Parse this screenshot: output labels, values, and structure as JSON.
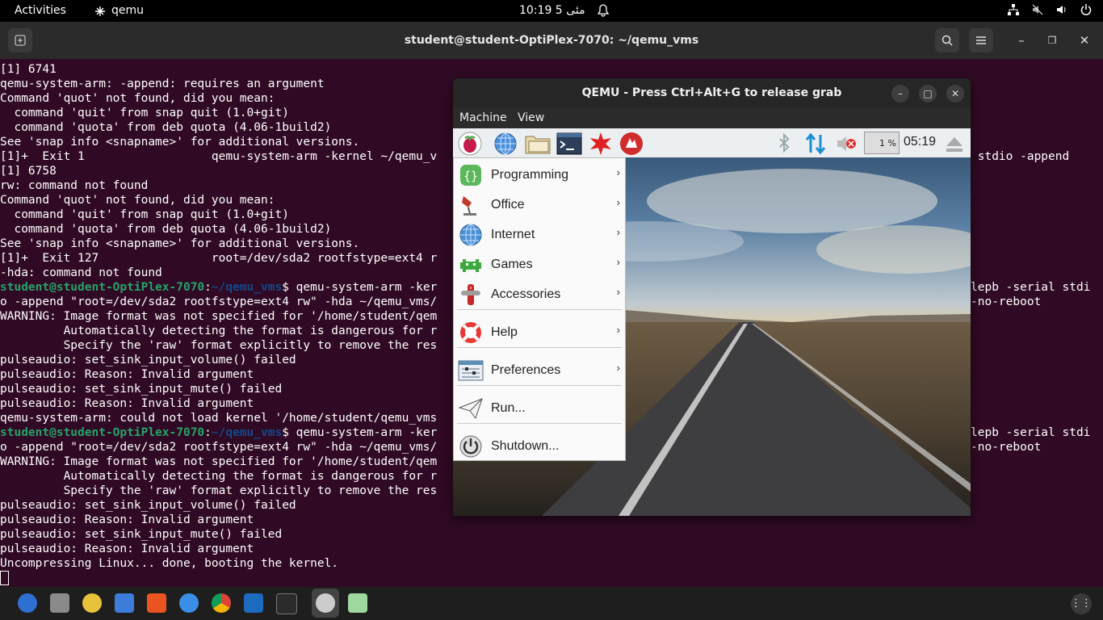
{
  "topbar": {
    "activities": "Activities",
    "app_name": "qemu",
    "clock": "10:19  مئی 5",
    "icons": [
      "network-icon",
      "speaker-muted-icon",
      "volume-icon",
      "power-icon"
    ]
  },
  "terminal": {
    "title": "student@student-OptiPlex-7070: ~/qemu_vms",
    "lines": [
      "[1] 6741",
      "qemu-system-arm: -append: requires an argument",
      "Command 'quot' not found, did you mean:",
      "  command 'quit' from snap quit (1.0+git)",
      "  command 'quota' from deb quota (4.06-1build2)",
      "See 'snap info <snapname>' for additional versions.",
      "[1]+  Exit 1                  qemu-system-arm -kernel ~/qemu_v",
      "[1] 6758",
      "rw: command not found",
      "Command 'quot' not found, did you mean:",
      "  command 'quit' from snap quit (1.0+git)",
      "  command 'quota' from deb quota (4.06-1build2)",
      "See 'snap info <snapname>' for additional versions.",
      "[1]+  Exit 127                root=/dev/sda2 rootfstype=ext4 r",
      "-hda: command not found",
      "PROMPT qemu-system-arm -ker",
      "o -append \"root=/dev/sda2 rootfstype=ext4 rw\" -hda ~/qemu_vms/",
      "WARNING: Image format was not specified for '/home/student/qem",
      "         Automatically detecting the format is dangerous for r",
      "         Specify the 'raw' format explicitly to remove the res",
      "pulseaudio: set_sink_input_volume() failed",
      "pulseaudio: Reason: Invalid argument",
      "pulseaudio: set_sink_input_mute() failed",
      "pulseaudio: Reason: Invalid argument",
      "qemu-system-arm: could not load kernel '/home/student/qemu_vms",
      "PROMPT qemu-system-arm -ker",
      "o -append \"root=/dev/sda2 rootfstype=ext4 rw\" -hda ~/qemu_vms/",
      "WARNING: Image format was not specified for '/home/student/qem",
      "         Automatically detecting the format is dangerous for r",
      "         Specify the 'raw' format explicitly to remove the res",
      "pulseaudio: set_sink_input_volume() failed",
      "pulseaudio: Reason: Invalid argument",
      "pulseaudio: set_sink_input_mute() failed",
      "pulseaudio: Reason: Invalid argument",
      "Uncompressing Linux... done, booting the kernel."
    ],
    "prompt_user": "student@student-OptiPlex-7070",
    "prompt_sep": ":",
    "prompt_path": "~/qemu_vms",
    "prompt_dollar": "$ ",
    "right_lines": [
      {
        "row": 6,
        "text": " stdio -append"
      },
      {
        "row": 15,
        "text": "lepb -serial stdi"
      },
      {
        "row": 16,
        "text": "-no-reboot"
      },
      {
        "row": 25,
        "text": "lepb -serial stdi"
      },
      {
        "row": 26,
        "text": "-no-reboot"
      }
    ]
  },
  "qemu": {
    "title": "QEMU - Press Ctrl+Alt+G to release grab",
    "menu": {
      "machine": "Machine",
      "view": "View"
    },
    "panel": {
      "cpu": "1 %",
      "clock": "05:19"
    },
    "start_menu": [
      {
        "label": "Programming",
        "icon": "programming-icon",
        "submenu": true
      },
      {
        "label": "Office",
        "icon": "office-icon",
        "submenu": true
      },
      {
        "label": "Internet",
        "icon": "internet-icon",
        "submenu": true
      },
      {
        "label": "Games",
        "icon": "games-icon",
        "submenu": true
      },
      {
        "label": "Accessories",
        "icon": "accessories-icon",
        "submenu": true
      },
      {
        "label": "Help",
        "icon": "help-icon",
        "submenu": true
      },
      {
        "label": "Preferences",
        "icon": "preferences-icon",
        "submenu": true
      },
      {
        "label": "Run...",
        "icon": "run-icon",
        "submenu": false
      },
      {
        "label": "Shutdown...",
        "icon": "shutdown-icon",
        "submenu": false
      }
    ]
  },
  "dock": {
    "apps": [
      "thunderbird-icon",
      "files-icon",
      "rhythmbox-icon",
      "libreoffice-writer-icon",
      "software-center-icon",
      "help-icon",
      "chrome-icon",
      "virtualbox-icon",
      "terminal-icon",
      "qemu-icon",
      "trash-icon"
    ]
  }
}
